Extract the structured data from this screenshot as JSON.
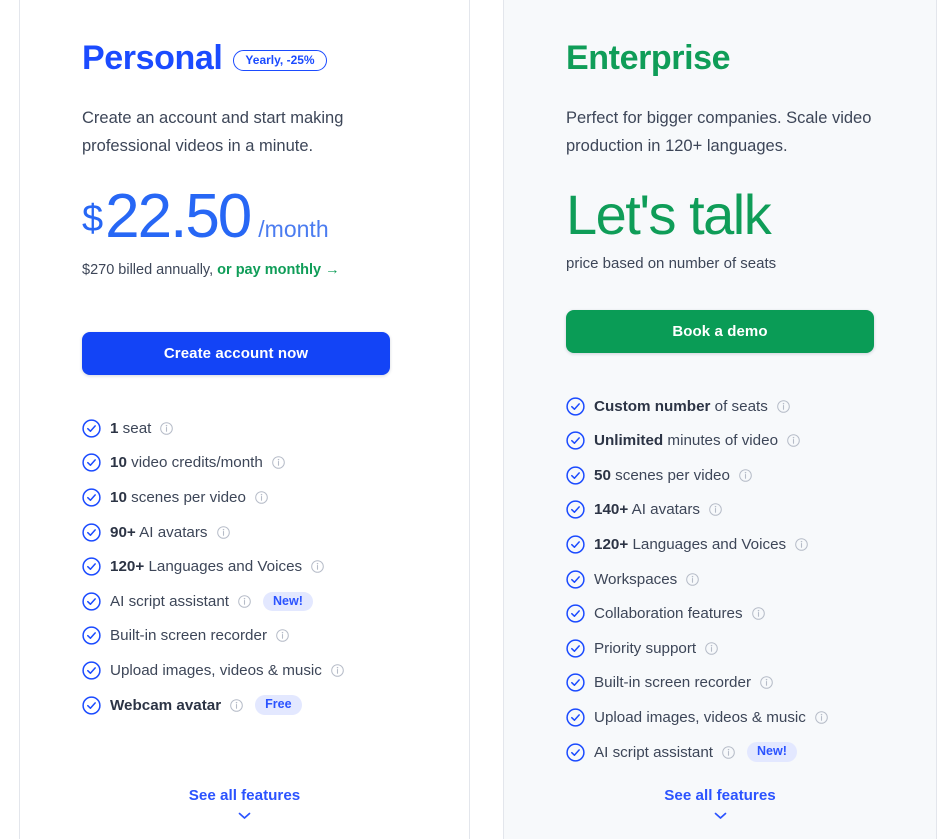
{
  "colors": {
    "personal_accent": "#1b4bff",
    "personal_button": "#1344f6",
    "enterprise_accent": "#0f9d58",
    "enterprise_button": "#0a9c56",
    "price_blue": "#2767f5",
    "badge_bg": "#e3e8ff",
    "badge_text": "#2b53ff",
    "body_text": "#3d4658",
    "card_border": "#e3e6ec",
    "enterprise_card_bg": "#f7f9fb"
  },
  "plans": [
    {
      "id": "personal",
      "title": "Personal",
      "title_badge": "Yearly, -25%",
      "description": "Create an account and start making professional videos in a minute.",
      "price": {
        "currency": "$",
        "amount": "22.50",
        "period": "/month",
        "billed_note_prefix": "$270 billed annually,",
        "billed_note_link": "or pay monthly →"
      },
      "cta_label": "Create account now",
      "features": [
        {
          "bold": "1",
          "text": " seat",
          "info": true
        },
        {
          "bold": "10",
          "text": " video credits/month",
          "info": true
        },
        {
          "bold": "10",
          "text": " scenes per video",
          "info": true
        },
        {
          "bold": "90+",
          "text": " AI avatars",
          "info": true
        },
        {
          "bold": "120+",
          "text": " Languages and Voices",
          "info": true
        },
        {
          "bold": "",
          "text": "AI script assistant",
          "info": true,
          "badge": "New!"
        },
        {
          "bold": "",
          "text": "Built-in screen recorder",
          "info": true
        },
        {
          "bold": "",
          "text": "Upload images, videos & music",
          "info": true
        },
        {
          "bold": "Webcam avatar",
          "text": "",
          "info": true,
          "badge": "Free"
        }
      ],
      "footer_link": "See all features"
    },
    {
      "id": "enterprise",
      "title": "Enterprise",
      "title_badge": "",
      "description": "Perfect for bigger companies. Scale video production in 120+ languages.",
      "price": {
        "headline": "Let's talk",
        "subtext": "price based on number of seats"
      },
      "cta_label": "Book a demo",
      "features": [
        {
          "bold": "Custom number",
          "text": " of seats",
          "info": true
        },
        {
          "bold": "Unlimited",
          "text": " minutes of video",
          "info": true
        },
        {
          "bold": "50",
          "text": " scenes per video",
          "info": true
        },
        {
          "bold": "140+",
          "text": " AI avatars",
          "info": true
        },
        {
          "bold": "120+",
          "text": " Languages and Voices",
          "info": true
        },
        {
          "bold": "",
          "text": "Workspaces",
          "info": true
        },
        {
          "bold": "",
          "text": "Collaboration features",
          "info": true
        },
        {
          "bold": "",
          "text": "Priority support",
          "info": true
        },
        {
          "bold": "",
          "text": "Built-in screen recorder",
          "info": true
        },
        {
          "bold": "",
          "text": "Upload images, videos & music",
          "info": true
        },
        {
          "bold": "",
          "text": "AI script assistant",
          "info": true,
          "badge": "New!"
        }
      ],
      "footer_link": "See all features"
    }
  ]
}
